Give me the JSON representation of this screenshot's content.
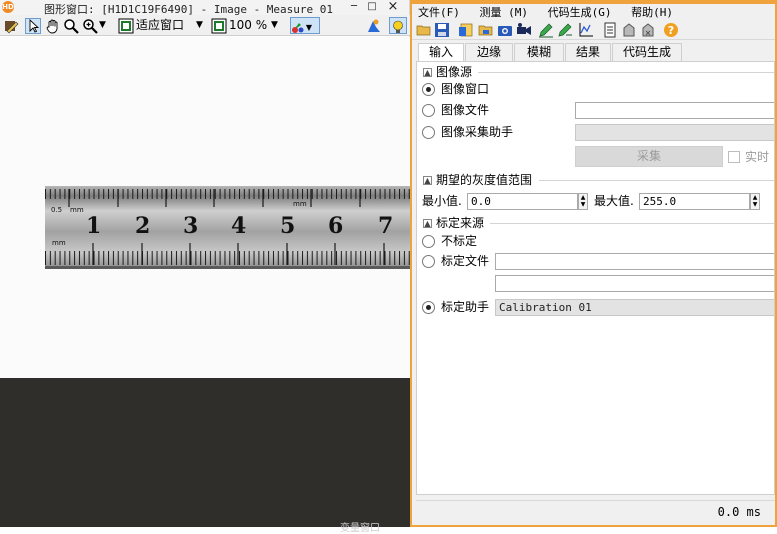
{
  "graphics_window": {
    "title": "图形窗口: [H1D1C19F6490] - Image - Measure 01",
    "app_icon_text": "HD",
    "minimize_glyph": "─",
    "maximize_glyph": "□",
    "close_glyph": "×",
    "toolbar": {
      "fit_label": "适应窗口",
      "zoom_label": "100 %"
    },
    "ruler": {
      "numbers": [
        "1",
        "2",
        "3",
        "4",
        "5",
        "6",
        "7"
      ],
      "labels_05": "0.5",
      "labels_mm": "mm"
    },
    "bottom_text": "变量窗口"
  },
  "measure_window": {
    "menu": {
      "file": "文件(F)",
      "measure": "测量 (M)",
      "codegen": "代码生成(G)",
      "help": "帮助(H)"
    },
    "tabs": [
      "输入",
      "边缘",
      "模糊",
      "结果",
      "代码生成"
    ],
    "image_source": {
      "title": "图像源",
      "collapse_glyph": "▲",
      "opt_window": "图像窗口",
      "opt_file": "图像文件",
      "opt_acq": "图像采集助手",
      "file_value": "",
      "acquire_button": "采集",
      "realtime_label": "实时"
    },
    "gray_range": {
      "title": "期望的灰度值范围",
      "min_label": "最小值.",
      "min_value": "0.0",
      "max_label": "最大值.",
      "max_value": "255.0"
    },
    "calib_source": {
      "title": "标定来源",
      "opt_none": "不标定",
      "opt_file": "标定文件",
      "file_value": "",
      "file_value2": "",
      "opt_assistant": "标定助手",
      "assistant_value": "Calibration 01"
    },
    "status": {
      "time": "0.0 ms"
    }
  }
}
